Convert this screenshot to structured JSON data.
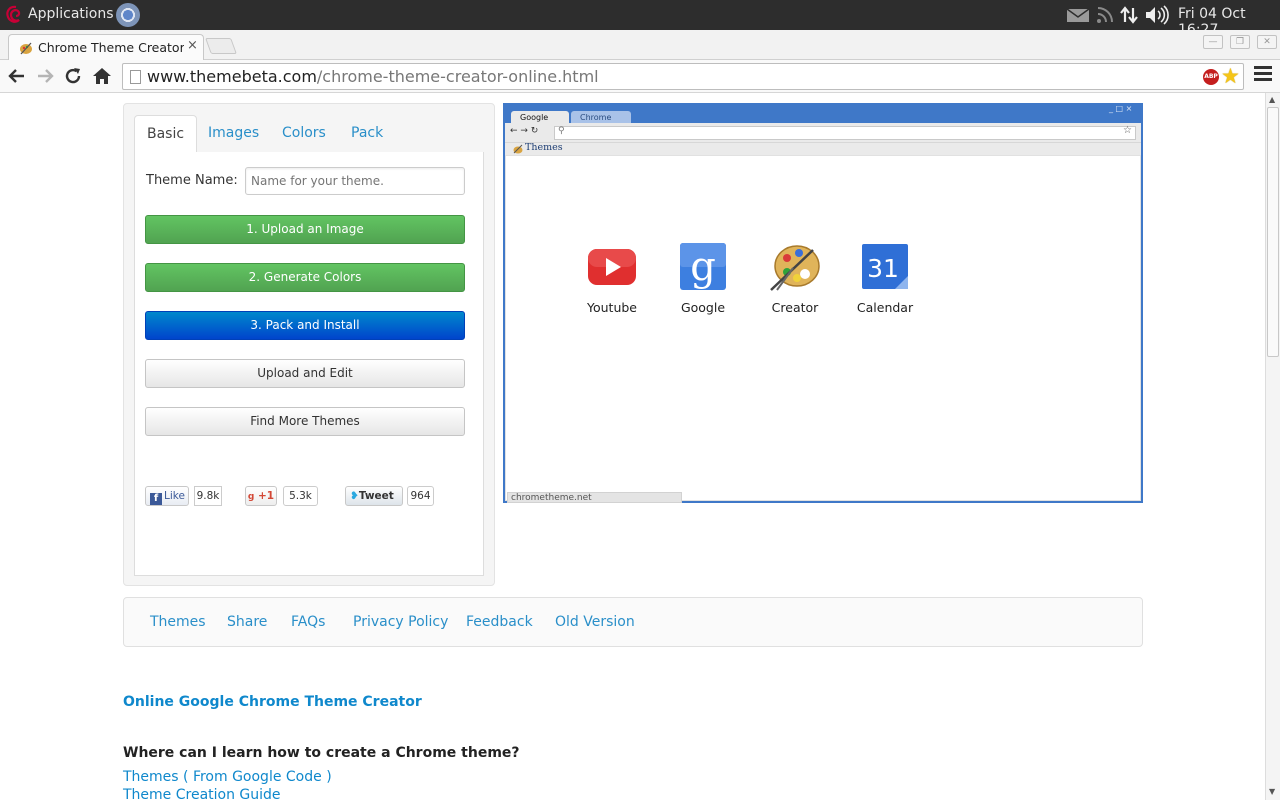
{
  "system_panel": {
    "applications_label": "Applications",
    "clock": "Fri 04 Oct 16:27"
  },
  "browser": {
    "tab_title": "Chrome Theme Creator",
    "tab_close": "×",
    "url_host": "www.themebeta.com",
    "url_path": "/chrome-theme-creator-online.html",
    "abp_label": "ABP"
  },
  "left_panel": {
    "tabs": [
      "Basic",
      "Images",
      "Colors",
      "Pack"
    ],
    "theme_name_label": "Theme Name:",
    "theme_name_placeholder": "Name for your theme.",
    "buttons": {
      "upload_image": "1. Upload an Image",
      "generate_colors": "2. Generate Colors",
      "pack_install": "3. Pack and Install",
      "upload_edit": "Upload and Edit",
      "find_more": "Find More Themes"
    },
    "social": {
      "like_label": "Like",
      "like_count": "9.8k",
      "plusone_label": "+1",
      "plusone_count": "5.3k",
      "tweet_label": "Tweet",
      "tweet_count": "964"
    }
  },
  "preview": {
    "tabs": [
      "Google",
      "Chrome"
    ],
    "bookmark": "Themes",
    "apps": [
      "Youtube",
      "Google",
      "Creator",
      "Calendar"
    ],
    "calendar_number": "31",
    "google_letter": "g",
    "status_text": "chrometheme.net"
  },
  "footer_nav": [
    "Themes",
    "Share",
    "FAQs",
    "Privacy Policy",
    "Feedback",
    "Old Version"
  ],
  "article": {
    "title": "Online Google Chrome Theme Creator",
    "question": "Where can I learn how to create a Chrome theme?",
    "links": [
      "Themes ( From Google Code )",
      "Theme Creation Guide"
    ]
  },
  "colors": {
    "accent_link": "#2a8fc9",
    "green_button": "#5bb75b",
    "blue_button": "#0066cc",
    "preview_frame": "#3f78c8"
  }
}
